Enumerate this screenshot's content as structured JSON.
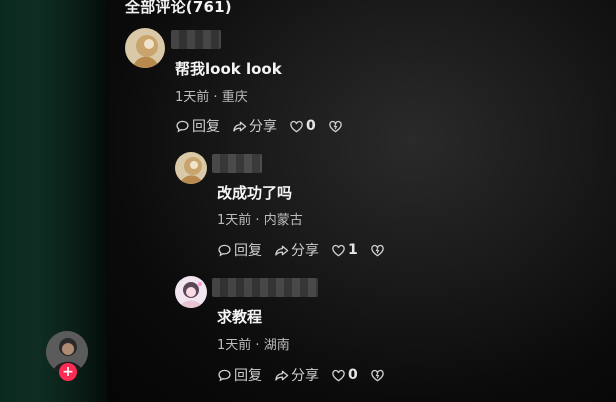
{
  "header": {
    "title": "全部评论(761)"
  },
  "comments": [
    {
      "text": "帮我look look",
      "time": "1天前",
      "location": "重庆",
      "reply_label": "回复",
      "share_label": "分享",
      "likes": "0"
    },
    {
      "text": "改成功了吗",
      "time": "1天前",
      "location": "内蒙古",
      "reply_label": "回复",
      "share_label": "分享",
      "likes": "1"
    },
    {
      "text": "求教程",
      "time": "1天前",
      "location": "湖南",
      "reply_label": "回复",
      "share_label": "分享",
      "likes": "0"
    }
  ],
  "side": {
    "follow_badge": "+"
  },
  "colors": {
    "background": "#050505",
    "left_strip": "#0f2d22",
    "badge": "#fe2c55"
  },
  "icons": [
    "comment-icon",
    "share-icon",
    "heart-icon",
    "dislike-icon",
    "avatar",
    "follow-plus-icon"
  ]
}
